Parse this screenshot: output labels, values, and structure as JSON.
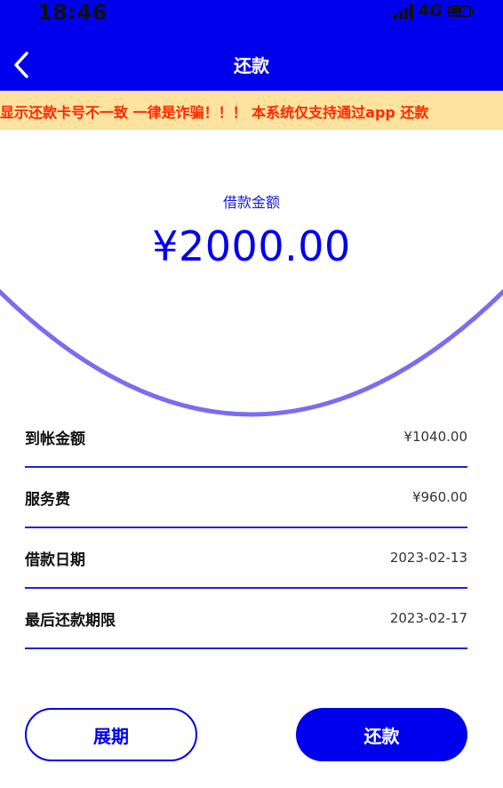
{
  "status_bar": {
    "time": "18:46",
    "network": "4G"
  },
  "nav": {
    "title": "还款",
    "back_icon": "chevron-left-icon"
  },
  "notice": {
    "text": "显示还款卡号不一致 一律是诈骗！！！ 本系统仅支持通过app 还款"
  },
  "loan": {
    "label": "借款金额",
    "amount": "¥2000.00"
  },
  "details": [
    {
      "label": "到帐金额",
      "value": "¥1040.00"
    },
    {
      "label": "服务费",
      "value": "¥960.00"
    },
    {
      "label": "借款日期",
      "value": "2023-02-13"
    },
    {
      "label": "最后还款期限",
      "value": "2023-02-17"
    }
  ],
  "actions": {
    "extend_label": "展期",
    "repay_label": "还款"
  },
  "colors": {
    "primary": "#0000ee",
    "notice_bg": "#fde2a0",
    "notice_text": "#ff2a00",
    "arc": "#7b6cf0"
  }
}
